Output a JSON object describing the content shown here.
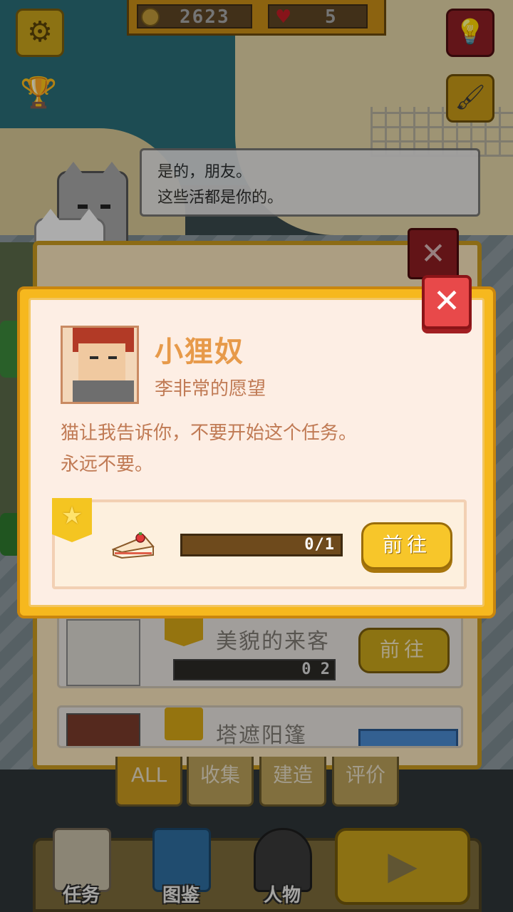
{
  "hud": {
    "coins": "2623",
    "hearts": "5"
  },
  "speech": {
    "line1": "是的，朋友。",
    "line2": "这些活都是你的。"
  },
  "bg_tasks": [
    {
      "title": "美貌的来客",
      "progress": "0 2",
      "button": "前往"
    },
    {
      "title": "塔遮阳篷"
    }
  ],
  "tabs": [
    "ALL",
    "收集",
    "建造",
    "评价"
  ],
  "nav": {
    "task": "任务",
    "book": "图鉴",
    "people": "人物"
  },
  "modal": {
    "name": "小狸奴",
    "subtitle": "李非常的愿望",
    "desc_line1": "猫让我告诉你，不要开始这个任务。",
    "desc_line2": "永远不要。",
    "task": {
      "item": "cake-icon",
      "progress_text": "0/1",
      "progress_fraction": 0,
      "button": "前往"
    }
  },
  "colors": {
    "modal_accent": "#f6b81e",
    "name_text": "#e79a4a",
    "close_red": "#e8494a"
  }
}
